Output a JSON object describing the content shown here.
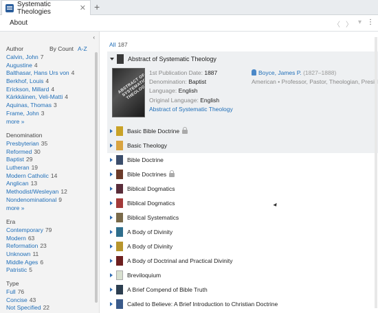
{
  "tab": {
    "title": "Systematic Theologies",
    "close": "✕",
    "add": "+"
  },
  "toolbar": {
    "about": "About",
    "back": "〈",
    "forward": "〉",
    "dropdown": "▾",
    "menu": "⋮"
  },
  "sidebar": {
    "collapse": "‹",
    "author": {
      "title": "Author",
      "by_count": "By Count",
      "az": "A-Z",
      "items": [
        {
          "name": "Calvin, John",
          "count": "7"
        },
        {
          "name": "Augustine",
          "count": "4"
        },
        {
          "name": "Balthasar, Hans Urs von",
          "count": "4"
        },
        {
          "name": "Berkhof, Louis",
          "count": "4"
        },
        {
          "name": "Erickson, Millard",
          "count": "4"
        },
        {
          "name": "Kärkkäinen, Veli-Matti",
          "count": "4"
        },
        {
          "name": "Aquinas, Thomas",
          "count": "3"
        },
        {
          "name": "Frame, John",
          "count": "3"
        }
      ],
      "more": "more »"
    },
    "denomination": {
      "title": "Denomination",
      "items": [
        {
          "name": "Presbyterian",
          "count": "35"
        },
        {
          "name": "Reformed",
          "count": "30"
        },
        {
          "name": "Baptist",
          "count": "29"
        },
        {
          "name": "Lutheran",
          "count": "19"
        },
        {
          "name": "Modern Catholic",
          "count": "14"
        },
        {
          "name": "Anglican",
          "count": "13"
        },
        {
          "name": "Methodist/Wesleyan",
          "count": "12"
        },
        {
          "name": "Nondenominational",
          "count": "9"
        }
      ],
      "more": "more »"
    },
    "era": {
      "title": "Era",
      "items": [
        {
          "name": "Contemporary",
          "count": "79"
        },
        {
          "name": "Modern",
          "count": "63"
        },
        {
          "name": "Reformation",
          "count": "23"
        },
        {
          "name": "Unknown",
          "count": "11"
        },
        {
          "name": "Middle Ages",
          "count": "6"
        },
        {
          "name": "Patristic",
          "count": "5"
        }
      ]
    },
    "type": {
      "title": "Type",
      "items": [
        {
          "name": "Full",
          "count": "76"
        },
        {
          "name": "Concise",
          "count": "43"
        },
        {
          "name": "Not Specified",
          "count": "22"
        }
      ]
    }
  },
  "main": {
    "all_label": "All",
    "all_count": "187",
    "expanded": {
      "title": "Abstract of Systematic Theology",
      "cover_text": "ABSTRACT OF SYSTEMATIC THEOLOGY",
      "pub_label": "1st Publication Date:",
      "pub_value": "1887",
      "den_label": "Denomination:",
      "den_value": "Baptist",
      "lang_label": "Language:",
      "lang_value": "English",
      "orig_label": "Original Language:",
      "orig_value": "English",
      "link": "Abstract of Systematic Theology",
      "author_name": "Boyce, James P.",
      "author_years": "(1827–1888)",
      "author_desc": "American • Professor, Pastor, Theologian, President"
    },
    "items": [
      {
        "title": "Basic Bible Doctrine",
        "locked": true,
        "color": "#c9a227"
      },
      {
        "title": "Basic Theology",
        "locked": false,
        "color": "#d9a441"
      },
      {
        "title": "Bible Doctrine",
        "locked": false,
        "color": "#3b4d6b"
      },
      {
        "title": "Bible Doctrines",
        "locked": true,
        "color": "#6b3b2a"
      },
      {
        "title": "Biblical Dogmatics",
        "locked": false,
        "color": "#5a2d3a"
      },
      {
        "title": "Biblical Dogmatics",
        "locked": false,
        "color": "#a33a3a"
      },
      {
        "title": "Biblical Systematics",
        "locked": false,
        "color": "#7a6a4a"
      },
      {
        "title": "A Body of Divinity",
        "locked": false,
        "color": "#2f6e8c"
      },
      {
        "title": "A Body of Divinity",
        "locked": false,
        "color": "#b8962e"
      },
      {
        "title": "A Body of Doctrinal and Practical Divinity",
        "locked": false,
        "color": "#6e1f1f"
      },
      {
        "title": "Breviloquium",
        "locked": false,
        "color": "#d8e0d0"
      },
      {
        "title": "A Brief Compend of Bible Truth",
        "locked": false,
        "color": "#2c3e50"
      },
      {
        "title": "Called to Believe: A Brief Introduction to Christian Doctrine",
        "locked": false,
        "color": "#3a5a8a"
      }
    ]
  }
}
